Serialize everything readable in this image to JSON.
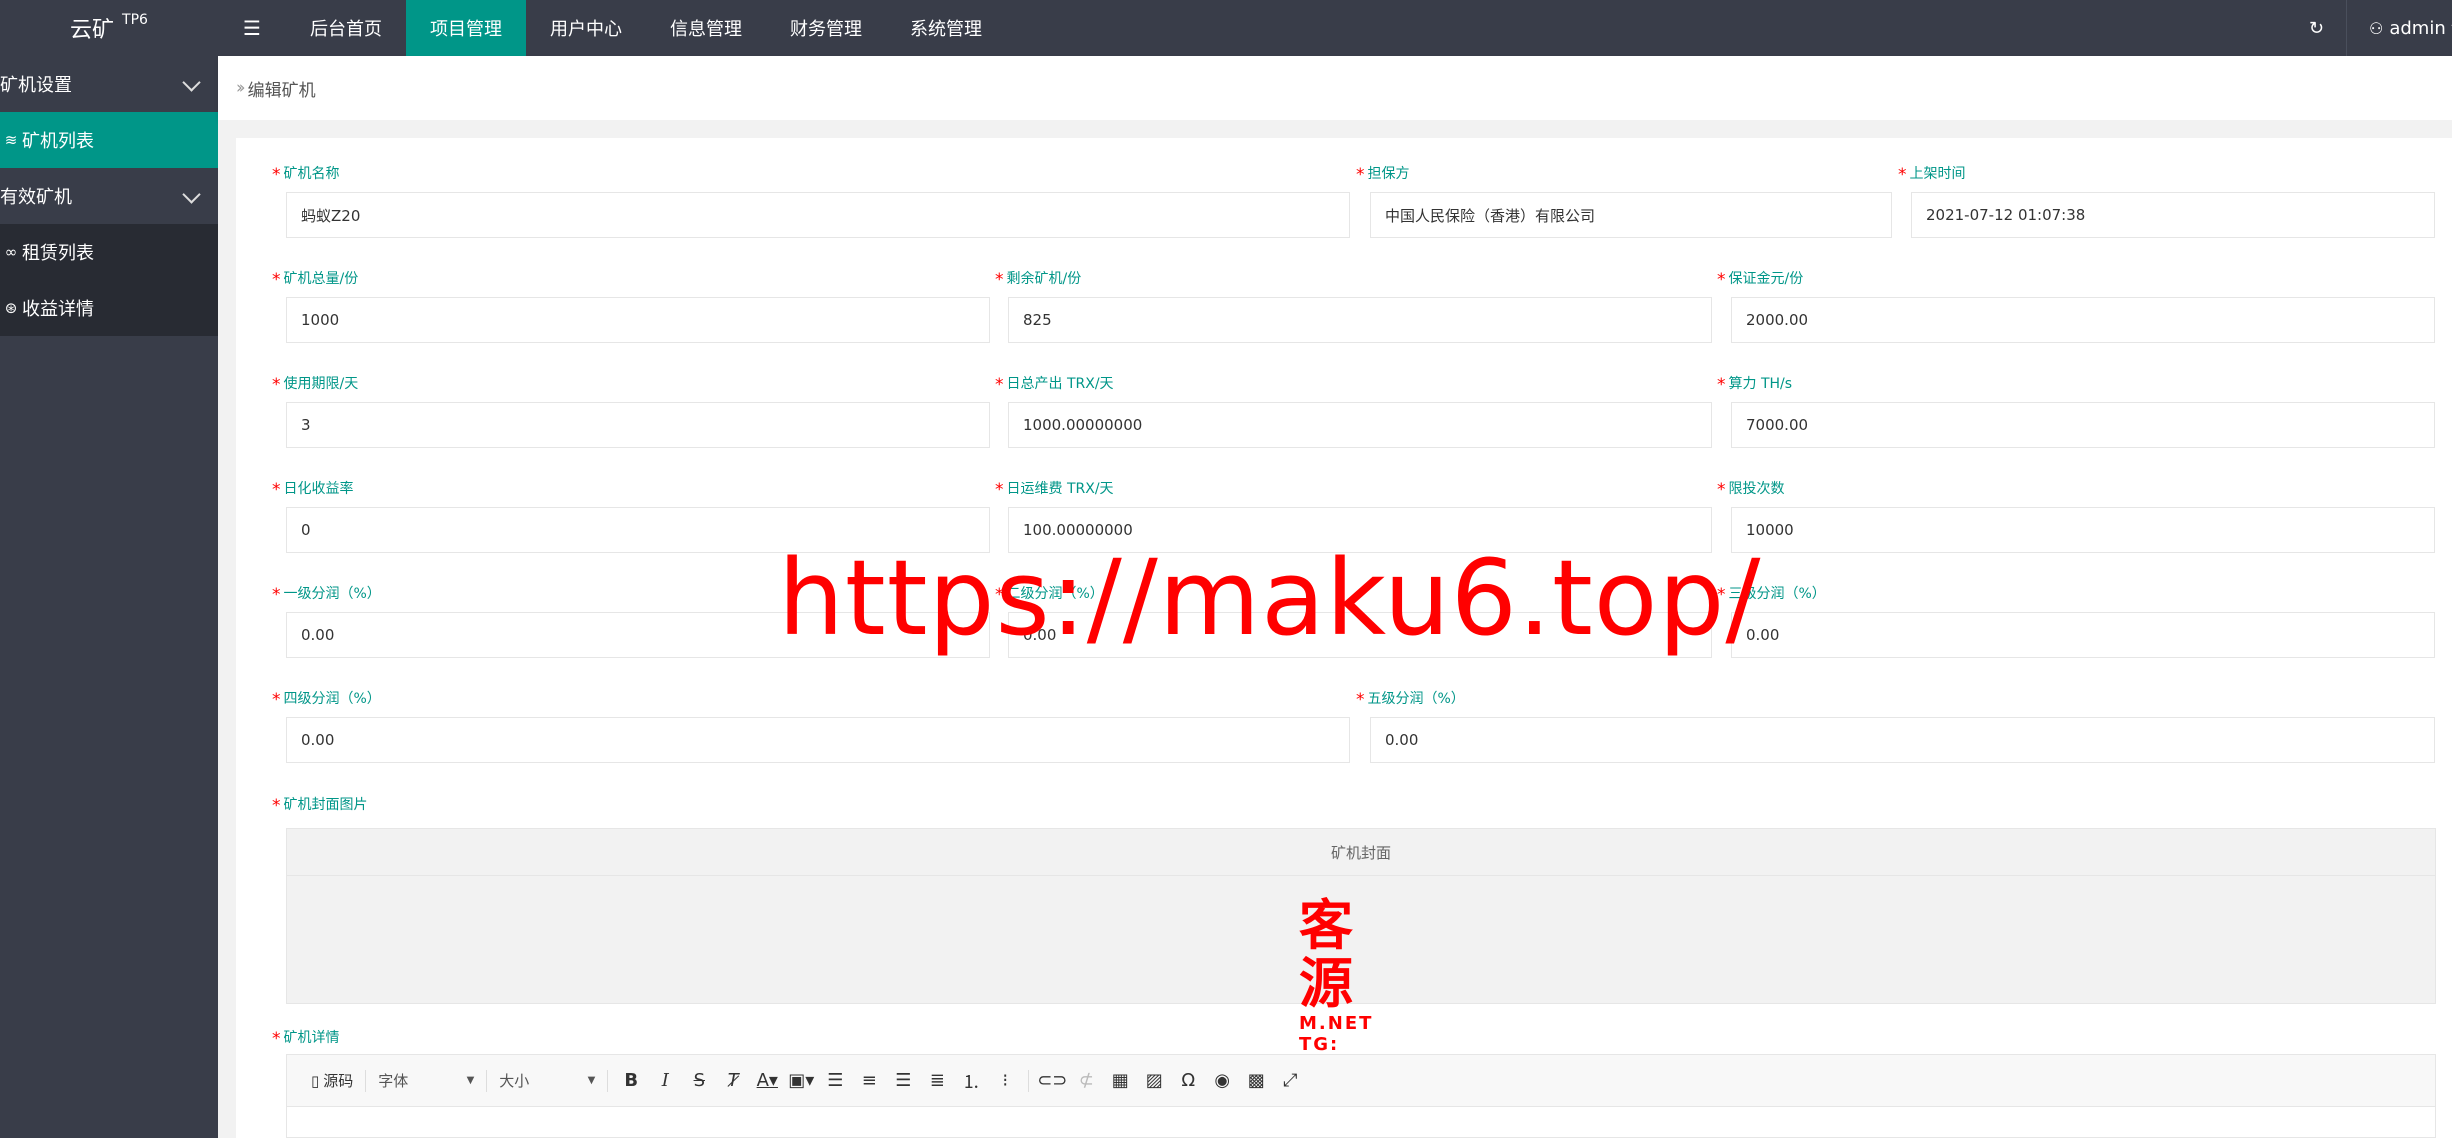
{
  "app": {
    "logo": "云矿",
    "logo_sup": "TP6"
  },
  "sidebar": {
    "items": [
      {
        "label": "矿机设置",
        "expanded": true
      },
      {
        "label": "矿机列表",
        "active": true
      },
      {
        "label": "有效矿机",
        "expanded": true
      },
      {
        "label": "租赁列表"
      },
      {
        "label": "收益详情"
      }
    ]
  },
  "topnav": {
    "tabs": [
      {
        "label": "后台首页"
      },
      {
        "label": "项目管理",
        "active": true
      },
      {
        "label": "用户中心"
      },
      {
        "label": "信息管理"
      },
      {
        "label": "财务管理"
      },
      {
        "label": "系统管理"
      }
    ],
    "user": "admin"
  },
  "breadcrumb": {
    "title": "编辑矿机"
  },
  "form": {
    "name": {
      "label": "矿机名称",
      "value": "蚂蚁Z20"
    },
    "guarantor": {
      "label": "担保方",
      "value": "中国人民保险（香港）有限公司"
    },
    "listed_time": {
      "label": "上架时间",
      "value": "2021-07-12 01:07:38"
    },
    "total": {
      "label": "矿机总量/份",
      "value": "1000"
    },
    "remaining": {
      "label": "剩余矿机/份",
      "value": "825"
    },
    "deposit": {
      "label": "保证金元/份",
      "value": "2000.00"
    },
    "period": {
      "label": "使用期限/天",
      "value": "3"
    },
    "daily_output": {
      "label": "日总产出 TRX/天",
      "value": "1000.00000000"
    },
    "hashrate": {
      "label": "算力 TH/s",
      "value": "7000.00"
    },
    "daily_rate": {
      "label": "日化收益率",
      "value": "0"
    },
    "daily_fee": {
      "label": "日运维费 TRX/天",
      "value": "100.00000000"
    },
    "limit": {
      "label": "限投次数",
      "value": "10000"
    },
    "level1": {
      "label": "一级分润（%）",
      "value": "0.00"
    },
    "level2": {
      "label": "二级分润（%）",
      "value": "0.00"
    },
    "level3": {
      "label": "三级分润（%）",
      "value": "0.00"
    },
    "level4": {
      "label": "四级分润（%）",
      "value": "0.00"
    },
    "level5": {
      "label": "五级分润（%）",
      "value": "0.00"
    },
    "cover": {
      "label": "矿机封面图片",
      "title": "矿机封面",
      "stamp_big": "客 源",
      "stamp_small": "M.NET TG:"
    },
    "detail": {
      "label": "矿机详情"
    }
  },
  "editor": {
    "source": "源码",
    "font": "字体",
    "size": "大小"
  },
  "watermark": "https://maku6.top/",
  "colors": {
    "accent": "#009688",
    "dark": "#393d49",
    "required": "#ff0000"
  }
}
